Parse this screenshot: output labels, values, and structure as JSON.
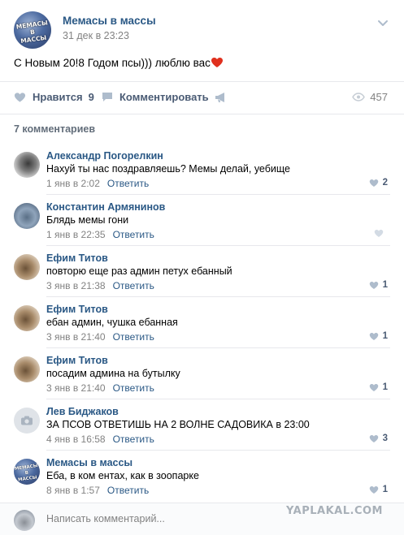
{
  "post": {
    "author": "Мемасы в массы",
    "date": "31 дек в 23:23",
    "avatar_logo": "МЕМАСЫ В МАССЫ",
    "text": "С Новым 20!8 Годом псы))) люблю вас",
    "heart_icon": "heart-emoji"
  },
  "actions": {
    "like_label": "Нравится",
    "like_count": "9",
    "comment_label": "Комментировать",
    "views": "457"
  },
  "comments_header": "7 комментариев",
  "comments": [
    {
      "author": "Александр Погорелкин",
      "text": "Нахуй ты нас поздравляешь? Мемы делай, уебище",
      "date": "1 янв в 2:02",
      "reply": "Ответить",
      "likes": "2",
      "avatar": "dark"
    },
    {
      "author": "Константин Армянинов",
      "text": "Блядь мемы гони",
      "date": "1 янв в 22:35",
      "reply": "Ответить",
      "likes": "",
      "avatar": "blue"
    },
    {
      "author": "Ефим Титов",
      "text": "повторю еще раз админ петух ебанный",
      "date": "3 янв в 21:38",
      "reply": "Ответить",
      "likes": "1",
      "avatar": "brown"
    },
    {
      "author": "Ефим Титов",
      "text": "ебан админ, чушка ебанная",
      "date": "3 янв в 21:40",
      "reply": "Ответить",
      "likes": "1",
      "avatar": "brown"
    },
    {
      "author": "Ефим Титов",
      "text": "посадим админа на бутылку",
      "date": "3 янв в 21:40",
      "reply": "Ответить",
      "likes": "1",
      "avatar": "brown"
    },
    {
      "author": "Лев Биджаков",
      "text": "ЗА ПСОВ ОТВЕТИШЬ НА 2 ВОЛНЕ САДОВИКА в 23:00",
      "date": "4 янв в 16:58",
      "reply": "Ответить",
      "likes": "3",
      "avatar": "gray"
    },
    {
      "author": "Мемасы в массы",
      "text": "Еба, в ком ентах, как в зоопарке",
      "date": "8 янв в 1:57",
      "reply": "Ответить",
      "likes": "1",
      "avatar": "group"
    }
  ],
  "comment_form": {
    "placeholder": "Написать комментарий..."
  },
  "watermark": "YAPLAKAL.COM",
  "colors": {
    "link": "#2a5885",
    "action": "#4a5b74",
    "muted": "#828282",
    "divider": "#e7e8ec",
    "icon": "#aebccc"
  }
}
